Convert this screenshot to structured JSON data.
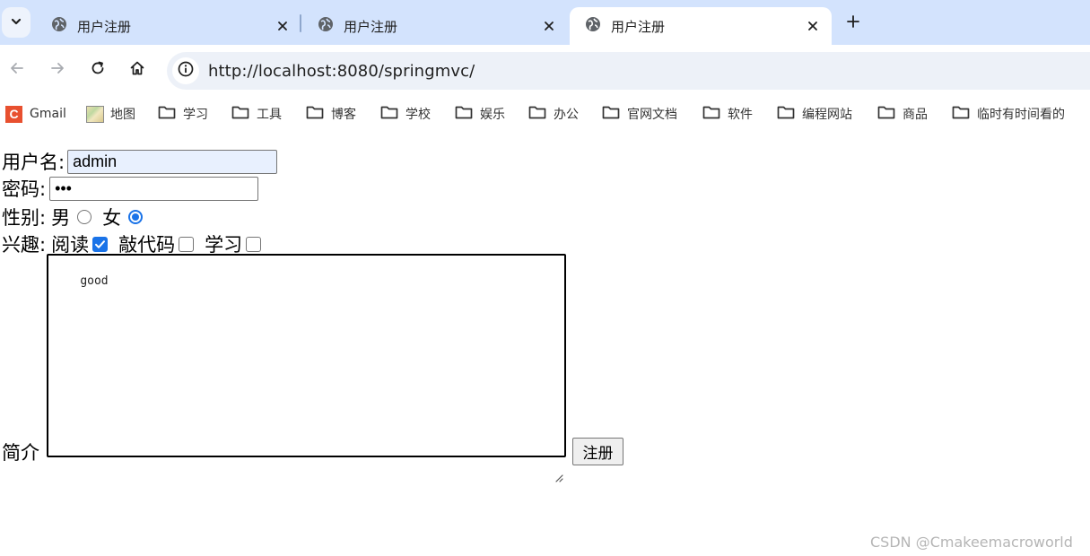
{
  "browser": {
    "tabs": [
      {
        "title": "用户注册",
        "active": false
      },
      {
        "title": "用户注册",
        "active": false
      },
      {
        "title": "用户注册",
        "active": true
      }
    ],
    "url": "http://localhost:8080/springmvc/",
    "bookmarks": [
      {
        "label": "Gmail",
        "icon": "gmail-icon"
      },
      {
        "label": "地图",
        "icon": "map-icon"
      },
      {
        "label": "学习",
        "icon": "folder-icon"
      },
      {
        "label": "工具",
        "icon": "folder-icon"
      },
      {
        "label": "博客",
        "icon": "folder-icon"
      },
      {
        "label": "学校",
        "icon": "folder-icon"
      },
      {
        "label": "娱乐",
        "icon": "folder-icon"
      },
      {
        "label": "办公",
        "icon": "folder-icon"
      },
      {
        "label": "官网文档",
        "icon": "folder-icon"
      },
      {
        "label": "软件",
        "icon": "folder-icon"
      },
      {
        "label": "编程网站",
        "icon": "folder-icon"
      },
      {
        "label": "商品",
        "icon": "folder-icon"
      },
      {
        "label": "临时有时间看的",
        "icon": "folder-icon"
      }
    ]
  },
  "form": {
    "username_label": "用户名:",
    "username_value": "admin",
    "password_label": "密码:",
    "password_value": "•••",
    "gender_label": "性别:",
    "gender_options": [
      {
        "label": "男",
        "checked": false
      },
      {
        "label": "女",
        "checked": true
      }
    ],
    "hobby_label": "兴趣:",
    "hobbies": [
      {
        "label": "阅读",
        "checked": true
      },
      {
        "label": "敲代码",
        "checked": false
      },
      {
        "label": "学习",
        "checked": false
      }
    ],
    "intro_label": "简介",
    "intro_value": "good",
    "submit_label": "注册"
  },
  "watermark": "CSDN @Cmakeemacroworld",
  "colors": {
    "tabstrip_bg": "#d3e3fd",
    "omnibox_bg": "#edf1f8",
    "accent": "#1a73e8",
    "autofill_bg": "#e8f0fe"
  }
}
